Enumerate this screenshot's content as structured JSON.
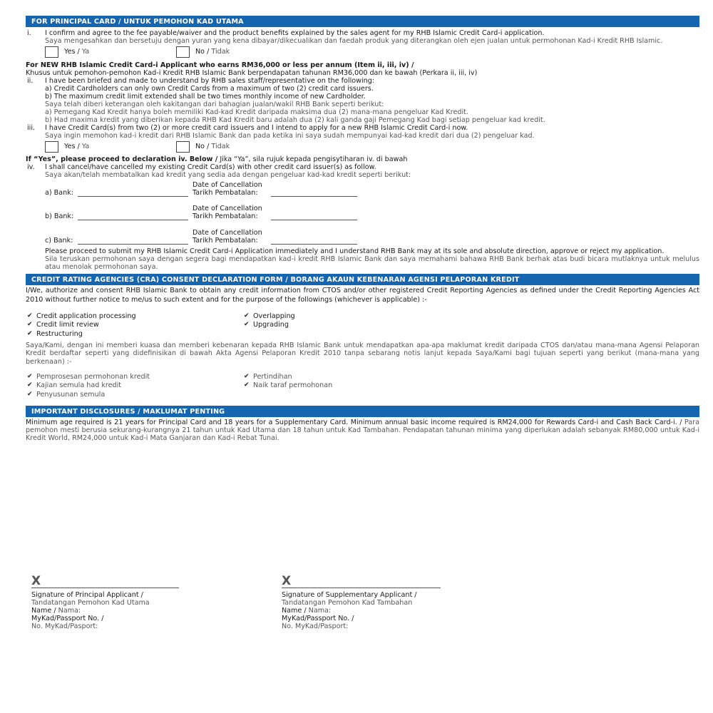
{
  "principal": {
    "header": "FOR PRINCIPAL CARD / UNTUK PEMOHON KAD UTAMA",
    "item_i": {
      "num": "i.",
      "en": "I confirm and agree to the fee payable/waiver and the product benefits explained by the sales agent for my RHB Islamic Credit Card-i application.",
      "bm": "Saya mengesahkan dan bersetuju dengan yuran yang kena dibayar/dikecualikan dan faedah produk yang diterangkan oleh ejen jualan untuk permohonan Kad-i Kredit RHB Islamic."
    },
    "opt_yes_en": "Yes /",
    "opt_yes_bm": "Ya",
    "opt_no_en": "No /",
    "opt_no_bm": "Tidak",
    "new_applicant_en": "For NEW RHB Islamic Credit Card-i Applicant who earns RM36,000 or less per annum  (Item ii, iii, iv) /",
    "new_applicant_bm": "Khusus untuk pemohon-pemohon Kad-i Kredit RHB Islamic Bank berpendapatan tahunan RM36,000 dan ke bawah (Perkara ii, iii, iv)",
    "item_ii": {
      "num": "ii.",
      "en": "I have been briefed and made to understand by RHB sales staff/representative on the following:",
      "en_a": "a) Credit Cardholders can only own Credit Cards from a maximum of two (2) credit card issuers.",
      "en_b": "b) The maximum credit limit extended shall be two times monthly income of new Cardholder.",
      "bm": "Saya telah diberi keterangan oleh kakitangan dari bahagian jualan/wakil RHB Bank seperti berikut:",
      "bm_a": "a) Pemegang Kad Kredit hanya boleh memiliki Kad-kad Kredit daripada maksima dua (2) mana-mana pengeluar Kad Kredit.",
      "bm_b": "b) Had maxima kredit yang diberikan kepada RHB Kad Kredit baru adalah dua (2) kali ganda gaji Pemegang Kad bagi setiap pengeluar kad kredit."
    },
    "item_iii": {
      "num": "iii.",
      "en": "I have Credit Card(s) from two (2) or more credit card issuers and I intend to apply for a new RHB Islamic Credit Card-i now.",
      "bm": "Saya ingin memohon kad-i kredit dari RHB Islamic Bank dan pada ketika ini saya sudah mempunyai kad-kad kredit dari dua (2) pengeluar kad."
    },
    "if_yes_en": "If “Yes”, please proceed to declaration iv. Below /",
    "if_yes_bm": "Jika “Ya”, sila rujuk kepada pengisytiharan iv. di bawah",
    "item_iv": {
      "num": "iv.",
      "en": "I shall cancel/have cancelled my existing Credit Card(s) with other credit card issuer(s) as follow.",
      "bm": "Saya akan/telah membatalkan kad kredit yang sedia ada dengan pengeluar kad-kad kredit seperti berikut:"
    },
    "banks": [
      {
        "label": "a) Bank:"
      },
      {
        "label": "b) Bank:"
      },
      {
        "label": "c) Bank:"
      }
    ],
    "date_en": "Date of Cancellation",
    "date_bm": "Tarikh Pembatalan:",
    "proceed_en": "Please proceed to submit my RHB Islamic Credit Card-i Application immediately and I understand RHB Bank may at its sole and absolute direction, approve or reject my application.",
    "proceed_bm": "Sila teruskan permohonan saya dengan segera bagi mendapatkan kad-i kredit RHB Islamic Bank dan saya memahami bahawa RHB Bank berhak atas budi bicara mutlaknya untuk melulus atau menolak permohonan saya."
  },
  "cra": {
    "header": "CREDIT RATING AGENCIES (CRA) CONSENT DECLARATION FORM / BORANG AKAUN KEBENARAN AGENSI PELAPORAN KREDIT",
    "en": "I/We, authorize and consent RHB Islamic Bank to obtain any credit information from CTOS and/or other registered Credit Reporting Agencies as defined under the Credit Reporting Agencies Act 2010 without further notice to me/us to such extent and for the purpose of the followings (whichever is applicable) :-",
    "en_items": [
      "Credit application processing",
      "Overlapping",
      "Credit limit review",
      "Upgrading",
      "Restructuring"
    ],
    "bm": "Saya/Kami, dengan ini memberi kuasa dan memberi kebenaran kepada RHB Islamic Bank untuk mendapatkan apa-apa maklumat kredit daripada CTOS dan/atau mana-mana Agensi Pelaporan Kredit berdaftar seperti yang didefinisikan di bawah Akta Agensi Pelaporan Kredit 2010 tanpa sebarang notis lanjut kepada Saya/Kami bagi tujuan seperti yang berikut (mana-mana yang berkenaan) :-",
    "bm_items": [
      "Pemprosesan permohonan kredit",
      "Pertindihan",
      "Kajian semula had kredit",
      "Naik taraf permohonan",
      "Penyusunan semula"
    ]
  },
  "disclosures": {
    "header": "IMPORTANT DISCLOSURES / MAKLUMAT PENTING",
    "en": "Minimum age required is 21 years for Principal Card and 18 years for a Supplementary Card. Minimum annual basic income required is RM24,000 for Rewards Card-i and Cash Back Card-i. /",
    "bm": "Para pemohon mesti berusia sekurang-kurangnya 21 tahun untuk Kad Utama dan 18 tahun untuk Kad Tambahan. Pendapatan tahunan minima yang diperlukan adalah sebanyak RM80,000 untuk Kad-i Kredit World, RM24,000 untuk Kad-i Mata Ganjaran dan Kad-i Rebat Tunai."
  },
  "signatures": {
    "mark": "X",
    "principal": {
      "title_en": "Signature of Principal Applicant /",
      "title_bm": "Tandatangan Pemohon Kad Utama"
    },
    "supplementary": {
      "title_en": "Signature of Supplementary Applicant /",
      "title_bm": "Tandatangan Pemohon Kad Tambahan"
    },
    "name_en": "Name /",
    "name_bm": "Nama:",
    "id_en": "MyKad/Passport No. /",
    "id_bm": "No. MyKad/Pasport:"
  }
}
